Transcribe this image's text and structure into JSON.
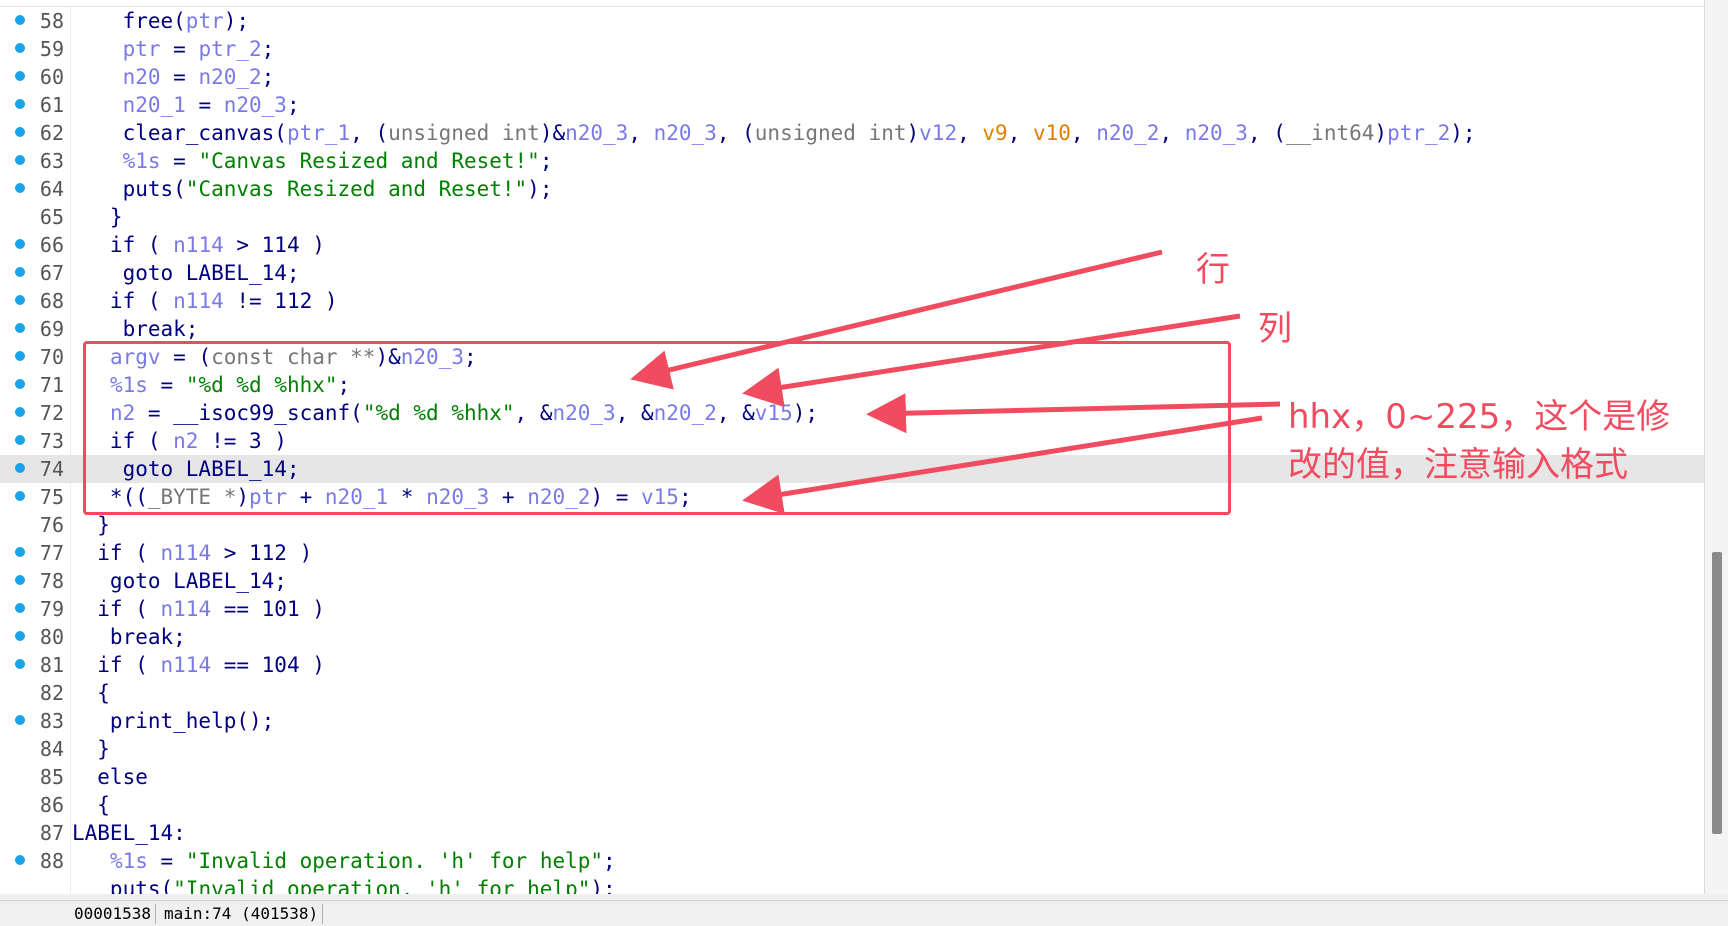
{
  "editor": {
    "current_line": "74",
    "lines": [
      {
        "no": "58",
        "dot": true,
        "tokens": [
          {
            "t": "    free(",
            "c": "t-plain"
          },
          {
            "t": "ptr",
            "c": "t-var"
          },
          {
            "t": ");",
            "c": "t-plain"
          }
        ]
      },
      {
        "no": "59",
        "dot": true,
        "tokens": [
          {
            "t": "    ",
            "c": "t-plain"
          },
          {
            "t": "ptr",
            "c": "t-var"
          },
          {
            "t": " = ",
            "c": "t-plain"
          },
          {
            "t": "ptr_2",
            "c": "t-var"
          },
          {
            "t": ";",
            "c": "t-plain"
          }
        ]
      },
      {
        "no": "60",
        "dot": true,
        "tokens": [
          {
            "t": "    ",
            "c": "t-plain"
          },
          {
            "t": "n20",
            "c": "t-var"
          },
          {
            "t": " = ",
            "c": "t-plain"
          },
          {
            "t": "n20_2",
            "c": "t-var"
          },
          {
            "t": ";",
            "c": "t-plain"
          }
        ]
      },
      {
        "no": "61",
        "dot": true,
        "tokens": [
          {
            "t": "    ",
            "c": "t-plain"
          },
          {
            "t": "n20_1",
            "c": "t-var"
          },
          {
            "t": " = ",
            "c": "t-plain"
          },
          {
            "t": "n20_3",
            "c": "t-var"
          },
          {
            "t": ";",
            "c": "t-plain"
          }
        ]
      },
      {
        "no": "62",
        "dot": true,
        "tokens": [
          {
            "t": "    clear_canvas(",
            "c": "t-plain"
          },
          {
            "t": "ptr_1",
            "c": "t-var"
          },
          {
            "t": ", (",
            "c": "t-plain"
          },
          {
            "t": "unsigned int",
            "c": "t-type"
          },
          {
            "t": ")&",
            "c": "t-plain"
          },
          {
            "t": "n20_3",
            "c": "t-var"
          },
          {
            "t": ", ",
            "c": "t-plain"
          },
          {
            "t": "n20_3",
            "c": "t-var"
          },
          {
            "t": ", (",
            "c": "t-plain"
          },
          {
            "t": "unsigned int",
            "c": "t-type"
          },
          {
            "t": ")",
            "c": "t-plain"
          },
          {
            "t": "v12",
            "c": "t-var"
          },
          {
            "t": ", ",
            "c": "t-plain"
          },
          {
            "t": "v9",
            "c": "t-orange"
          },
          {
            "t": ", ",
            "c": "t-plain"
          },
          {
            "t": "v10",
            "c": "t-orange"
          },
          {
            "t": ", ",
            "c": "t-plain"
          },
          {
            "t": "n20_2",
            "c": "t-var"
          },
          {
            "t": ", ",
            "c": "t-plain"
          },
          {
            "t": "n20_3",
            "c": "t-var"
          },
          {
            "t": ", (",
            "c": "t-plain"
          },
          {
            "t": "__int64",
            "c": "t-type"
          },
          {
            "t": ")",
            "c": "t-plain"
          },
          {
            "t": "ptr_2",
            "c": "t-var"
          },
          {
            "t": ");",
            "c": "t-plain"
          }
        ]
      },
      {
        "no": "63",
        "dot": true,
        "tokens": [
          {
            "t": "    ",
            "c": "t-plain"
          },
          {
            "t": "%1s",
            "c": "t-var"
          },
          {
            "t": " = ",
            "c": "t-plain"
          },
          {
            "t": "\"Canvas Resized and Reset!\"",
            "c": "t-str"
          },
          {
            "t": ";",
            "c": "t-plain"
          }
        ]
      },
      {
        "no": "64",
        "dot": true,
        "tokens": [
          {
            "t": "    puts(",
            "c": "t-plain"
          },
          {
            "t": "\"Canvas Resized and Reset!\"",
            "c": "t-str"
          },
          {
            "t": ");",
            "c": "t-plain"
          }
        ]
      },
      {
        "no": "65",
        "dot": false,
        "tokens": [
          {
            "t": "   }",
            "c": "t-plain"
          }
        ]
      },
      {
        "no": "66",
        "dot": true,
        "tokens": [
          {
            "t": "   if ( ",
            "c": "t-plain"
          },
          {
            "t": "n114",
            "c": "t-var"
          },
          {
            "t": " > 114 )",
            "c": "t-plain"
          }
        ]
      },
      {
        "no": "67",
        "dot": true,
        "tokens": [
          {
            "t": "    goto LABEL_14;",
            "c": "t-plain"
          }
        ]
      },
      {
        "no": "68",
        "dot": true,
        "tokens": [
          {
            "t": "   if ( ",
            "c": "t-plain"
          },
          {
            "t": "n114",
            "c": "t-var"
          },
          {
            "t": " != 112 )",
            "c": "t-plain"
          }
        ]
      },
      {
        "no": "69",
        "dot": true,
        "tokens": [
          {
            "t": "    break;",
            "c": "t-plain"
          }
        ]
      },
      {
        "no": "70",
        "dot": true,
        "tokens": [
          {
            "t": "   ",
            "c": "t-plain"
          },
          {
            "t": "argv",
            "c": "t-var"
          },
          {
            "t": " = (",
            "c": "t-plain"
          },
          {
            "t": "const char **",
            "c": "t-type"
          },
          {
            "t": ")&",
            "c": "t-plain"
          },
          {
            "t": "n20_3",
            "c": "t-var"
          },
          {
            "t": ";",
            "c": "t-plain"
          }
        ]
      },
      {
        "no": "71",
        "dot": true,
        "tokens": [
          {
            "t": "   ",
            "c": "t-plain"
          },
          {
            "t": "%1s",
            "c": "t-var"
          },
          {
            "t": " = ",
            "c": "t-plain"
          },
          {
            "t": "\"%d %d %hhx\"",
            "c": "t-str"
          },
          {
            "t": ";",
            "c": "t-plain"
          }
        ]
      },
      {
        "no": "72",
        "dot": true,
        "tokens": [
          {
            "t": "   ",
            "c": "t-plain"
          },
          {
            "t": "n2",
            "c": "t-var"
          },
          {
            "t": " = __isoc99_scanf(",
            "c": "t-plain"
          },
          {
            "t": "\"%d %d %hhx\"",
            "c": "t-str"
          },
          {
            "t": ", &",
            "c": "t-plain"
          },
          {
            "t": "n20_3",
            "c": "t-var"
          },
          {
            "t": ", &",
            "c": "t-plain"
          },
          {
            "t": "n20_2",
            "c": "t-var"
          },
          {
            "t": ", &",
            "c": "t-plain"
          },
          {
            "t": "v15",
            "c": "t-var"
          },
          {
            "t": ");",
            "c": "t-plain"
          }
        ]
      },
      {
        "no": "73",
        "dot": true,
        "tokens": [
          {
            "t": "   if ( ",
            "c": "t-plain"
          },
          {
            "t": "n2",
            "c": "t-var"
          },
          {
            "t": " != 3 )",
            "c": "t-plain"
          }
        ]
      },
      {
        "no": "74",
        "dot": true,
        "tokens": [
          {
            "t": "    goto LABEL_14;",
            "c": "t-plain"
          }
        ]
      },
      {
        "no": "75",
        "dot": true,
        "tokens": [
          {
            "t": "   *((",
            "c": "t-plain"
          },
          {
            "t": "_BYTE *",
            "c": "t-type"
          },
          {
            "t": ")",
            "c": "t-plain"
          },
          {
            "t": "ptr",
            "c": "t-var"
          },
          {
            "t": " + ",
            "c": "t-plain"
          },
          {
            "t": "n20_1",
            "c": "t-var"
          },
          {
            "t": " * ",
            "c": "t-plain"
          },
          {
            "t": "n20_3",
            "c": "t-var"
          },
          {
            "t": " + ",
            "c": "t-plain"
          },
          {
            "t": "n20_2",
            "c": "t-var"
          },
          {
            "t": ") = ",
            "c": "t-plain"
          },
          {
            "t": "v15",
            "c": "t-var"
          },
          {
            "t": ";",
            "c": "t-plain"
          }
        ]
      },
      {
        "no": "76",
        "dot": false,
        "tokens": [
          {
            "t": "  }",
            "c": "t-plain"
          }
        ]
      },
      {
        "no": "77",
        "dot": true,
        "tokens": [
          {
            "t": "  if ( ",
            "c": "t-plain"
          },
          {
            "t": "n114",
            "c": "t-var"
          },
          {
            "t": " > 112 )",
            "c": "t-plain"
          }
        ]
      },
      {
        "no": "78",
        "dot": true,
        "tokens": [
          {
            "t": "   goto LABEL_14;",
            "c": "t-plain"
          }
        ]
      },
      {
        "no": "79",
        "dot": true,
        "tokens": [
          {
            "t": "  if ( ",
            "c": "t-plain"
          },
          {
            "t": "n114",
            "c": "t-var"
          },
          {
            "t": " == 101 )",
            "c": "t-plain"
          }
        ]
      },
      {
        "no": "80",
        "dot": true,
        "tokens": [
          {
            "t": "   break;",
            "c": "t-plain"
          }
        ]
      },
      {
        "no": "81",
        "dot": true,
        "tokens": [
          {
            "t": "  if ( ",
            "c": "t-plain"
          },
          {
            "t": "n114",
            "c": "t-var"
          },
          {
            "t": " == 104 )",
            "c": "t-plain"
          }
        ]
      },
      {
        "no": "82",
        "dot": false,
        "tokens": [
          {
            "t": "  {",
            "c": "t-plain"
          }
        ]
      },
      {
        "no": "83",
        "dot": true,
        "tokens": [
          {
            "t": "   print_help();",
            "c": "t-plain"
          }
        ]
      },
      {
        "no": "84",
        "dot": false,
        "tokens": [
          {
            "t": "  }",
            "c": "t-plain"
          }
        ]
      },
      {
        "no": "85",
        "dot": false,
        "tokens": [
          {
            "t": "  else",
            "c": "t-plain"
          }
        ]
      },
      {
        "no": "86",
        "dot": false,
        "tokens": [
          {
            "t": "  {",
            "c": "t-plain"
          }
        ]
      },
      {
        "no": "87",
        "dot": false,
        "tokens": [
          {
            "t": "LABEL_14:",
            "c": "t-plain"
          }
        ]
      },
      {
        "no": "88",
        "dot": true,
        "tokens": [
          {
            "t": "   ",
            "c": "t-plain"
          },
          {
            "t": "%1s",
            "c": "t-var"
          },
          {
            "t": " = ",
            "c": "t-plain"
          },
          {
            "t": "\"Invalid operation. 'h' for help\"",
            "c": "t-str"
          },
          {
            "t": ";",
            "c": "t-plain"
          }
        ]
      },
      {
        "no": "",
        "dot": false,
        "tokens": [
          {
            "t": "   puts(",
            "c": "t-plain"
          },
          {
            "t": "\"Invalid operation. 'h' for help\"",
            "c": "t-str"
          },
          {
            "t": ");",
            "c": "t-plain"
          }
        ]
      }
    ]
  },
  "annotations": {
    "row_label": "行",
    "col_label": "列",
    "note_line1": "hhx，0~225，这个是修",
    "note_line2": "改的值，注意输入格式",
    "color": "#f04b5f"
  },
  "statusbar": {
    "address": "00001538",
    "location": "main:74 (401538)"
  }
}
